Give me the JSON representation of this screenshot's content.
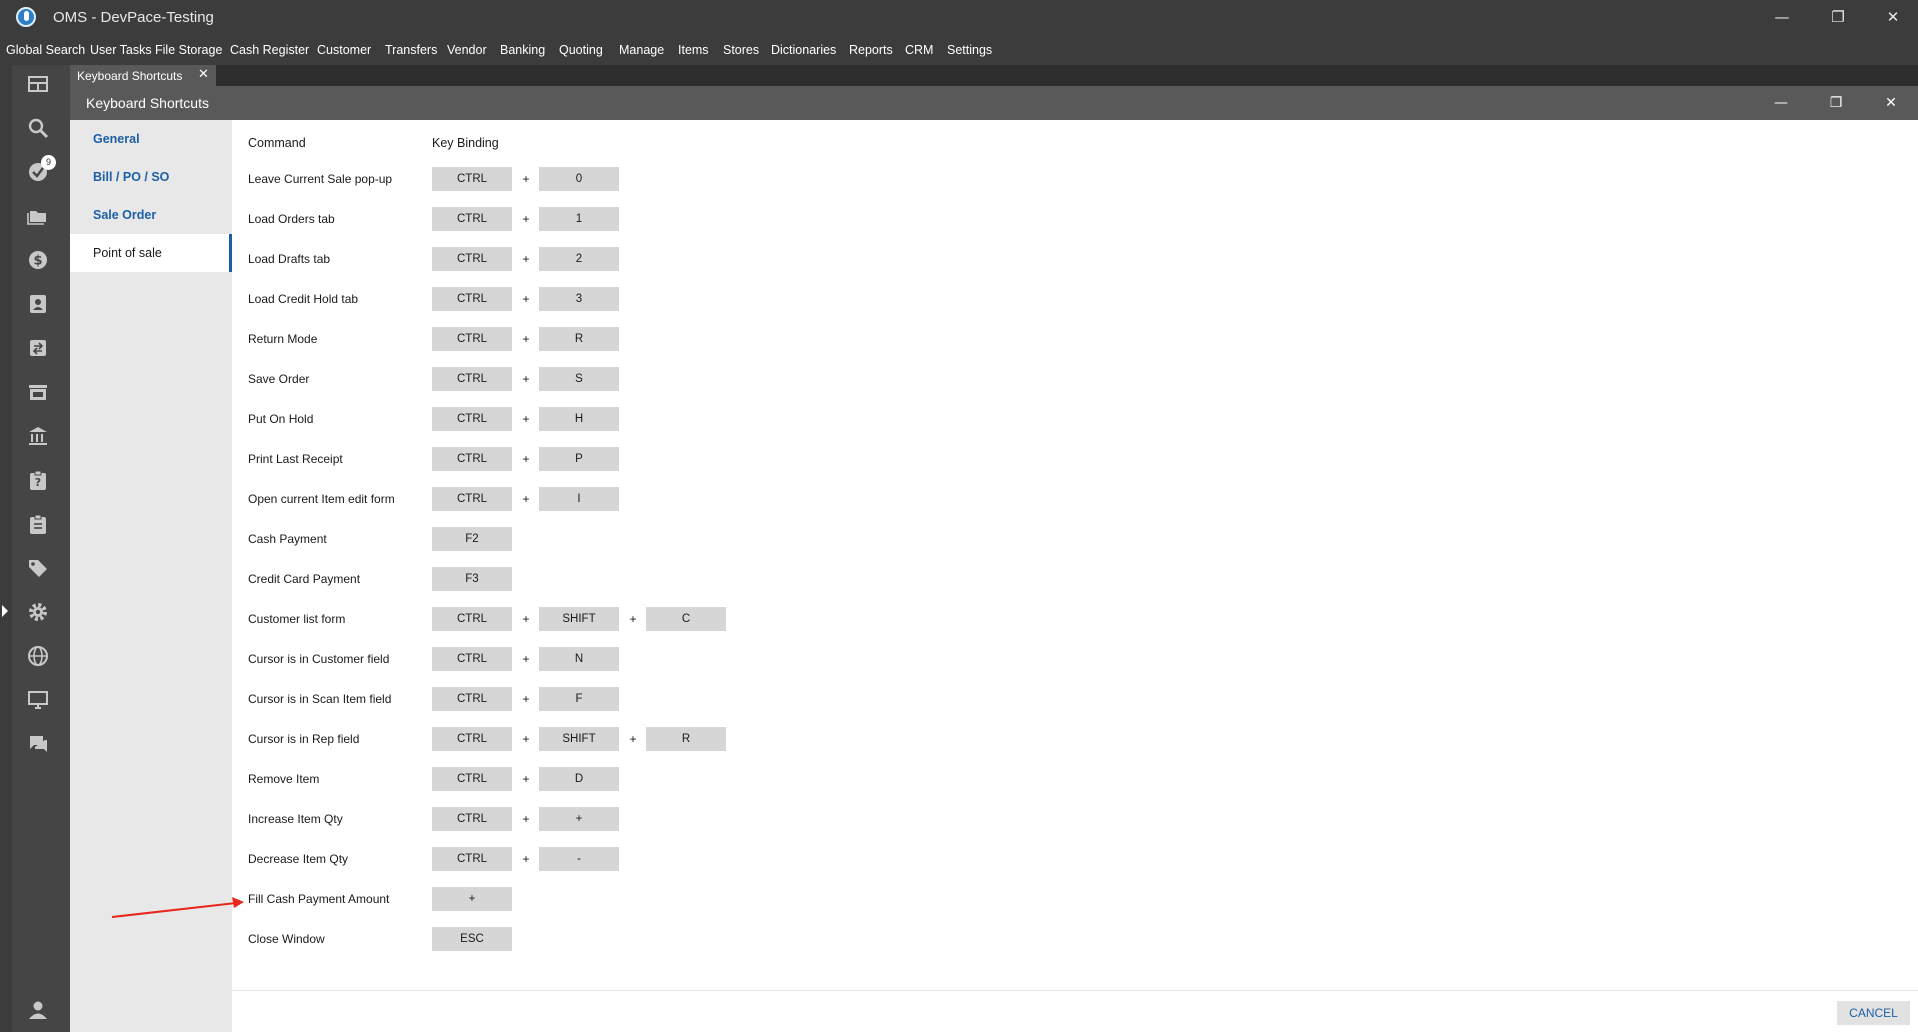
{
  "app": {
    "title": "OMS - DevPace-Testing"
  },
  "window_controls": {
    "minimize": "—",
    "restore": "❐",
    "close": "✕"
  },
  "menu": [
    "Global Search",
    "User Tasks",
    "File Storage",
    "Cash Register",
    "Customer",
    "Transfers",
    "Vendor",
    "Banking",
    "Quoting",
    "Manage",
    "Items",
    "Stores",
    "Dictionaries",
    "Reports",
    "CRM",
    "Settings"
  ],
  "rail": {
    "icons": [
      "dashboard-icon",
      "search-icon",
      "tasks-check-icon",
      "folder-icon",
      "dollar-icon",
      "contact-card-icon",
      "transfers-icon",
      "store-icon",
      "bank-icon",
      "clipboard-question-icon",
      "clipboard-list-icon",
      "tag-icon",
      "gear-icon",
      "globe-icon",
      "monitor-icon",
      "chat-icon",
      "user-icon"
    ],
    "badge": "9"
  },
  "doc_tab": {
    "label": "Keyboard Shortcuts",
    "close": "✕"
  },
  "dialog": {
    "title": "Keyboard Shortcuts"
  },
  "nav": {
    "items": [
      {
        "label": "General"
      },
      {
        "label": "Bill / PO / SO"
      },
      {
        "label": "Sale Order"
      },
      {
        "label": "Point of sale"
      }
    ],
    "active": "Point of sale"
  },
  "table": {
    "col_command": "Command",
    "col_binding": "Key Binding",
    "plus": "+",
    "rows": [
      {
        "command": "Leave Current Sale pop-up",
        "keys": [
          "CTRL",
          "0"
        ]
      },
      {
        "command": "Load Orders tab",
        "keys": [
          "CTRL",
          "1"
        ]
      },
      {
        "command": "Load Drafts tab",
        "keys": [
          "CTRL",
          "2"
        ]
      },
      {
        "command": "Load Credit Hold tab",
        "keys": [
          "CTRL",
          "3"
        ]
      },
      {
        "command": "Return Mode",
        "keys": [
          "CTRL",
          "R"
        ]
      },
      {
        "command": "Save Order",
        "keys": [
          "CTRL",
          "S"
        ]
      },
      {
        "command": "Put On Hold",
        "keys": [
          "CTRL",
          "H"
        ]
      },
      {
        "command": "Print Last Receipt",
        "keys": [
          "CTRL",
          "P"
        ]
      },
      {
        "command": "Open current Item edit form",
        "keys": [
          "CTRL",
          "I"
        ]
      },
      {
        "command": "Cash Payment",
        "keys": [
          "F2"
        ]
      },
      {
        "command": "Credit Card Payment",
        "keys": [
          "F3"
        ]
      },
      {
        "command": "Customer list form",
        "keys": [
          "CTRL",
          "SHIFT",
          "C"
        ]
      },
      {
        "command": "Cursor is in Customer field",
        "keys": [
          "CTRL",
          "N"
        ]
      },
      {
        "command": "Cursor is in Scan Item field",
        "keys": [
          "CTRL",
          "F"
        ]
      },
      {
        "command": "Cursor is in Rep field",
        "keys": [
          "CTRL",
          "SHIFT",
          "R"
        ]
      },
      {
        "command": "Remove Item",
        "keys": [
          "CTRL",
          "D"
        ]
      },
      {
        "command": "Increase Item Qty",
        "keys": [
          "CTRL",
          "+"
        ]
      },
      {
        "command": "Decrease Item Qty",
        "keys": [
          "CTRL",
          "-"
        ]
      },
      {
        "command": "Fill Cash Payment Amount",
        "keys": [
          "+"
        ]
      },
      {
        "command": "Close Window",
        "keys": [
          "ESC"
        ]
      }
    ]
  },
  "footer": {
    "cancel": "CANCEL"
  },
  "colors": {
    "chrome": "#3c3c3c",
    "header": "#595959",
    "accent": "#1d5fa5",
    "key_bg": "#d6d6d6",
    "annotation_arrow": "#e8261c"
  }
}
